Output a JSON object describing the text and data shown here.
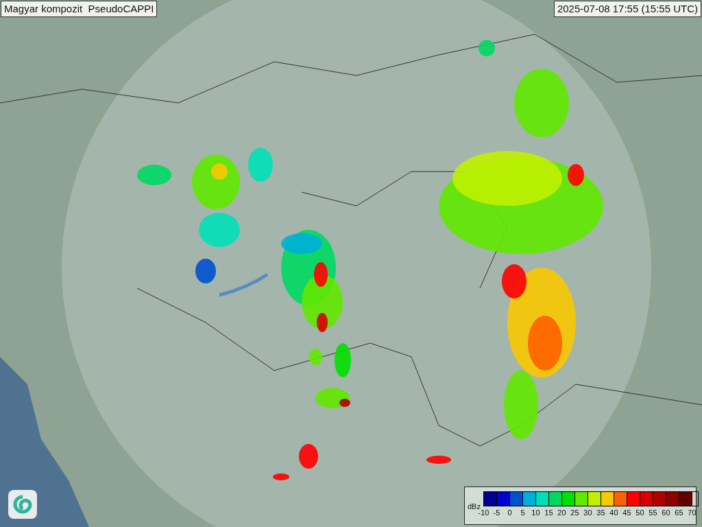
{
  "title": "Magyar kompozit  PseudoCAPPI",
  "timestamp": "2025-07-08 17:55 (15:55 UTC)",
  "legend": {
    "unit": "dBz",
    "bins": [
      {
        "color": "#000090"
      },
      {
        "color": "#0000d0"
      },
      {
        "color": "#0050d0"
      },
      {
        "color": "#00b0d8"
      },
      {
        "color": "#00e0b8"
      },
      {
        "color": "#00d860"
      },
      {
        "color": "#00e000"
      },
      {
        "color": "#60e800"
      },
      {
        "color": "#c0f000"
      },
      {
        "color": "#f8c800"
      },
      {
        "color": "#ff6000"
      },
      {
        "color": "#ff0000"
      },
      {
        "color": "#d80000"
      },
      {
        "color": "#b00000"
      },
      {
        "color": "#900000"
      },
      {
        "color": "#600000"
      }
    ],
    "ticks": [
      "-10",
      "-5",
      "0",
      "5",
      "10",
      "15",
      "20",
      "25",
      "30",
      "35",
      "40",
      "45",
      "50",
      "55",
      "60",
      "65",
      "70"
    ]
  }
}
